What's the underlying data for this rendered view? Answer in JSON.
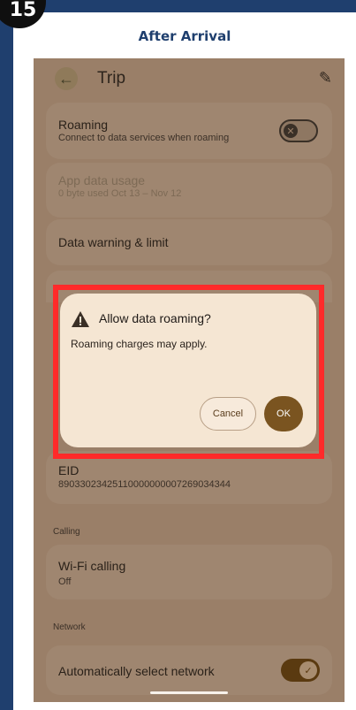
{
  "step": "15",
  "caption": "After Arrival",
  "app_bar": {
    "title": "Trip",
    "back_icon": "←",
    "edit_icon": "✎"
  },
  "settings": {
    "roaming": {
      "label": "Roaming",
      "sub": "Connect to data services when roaming",
      "state": "off"
    },
    "app_data_usage": {
      "label": "App data usage",
      "sub": "0 byte used Oct 13 – Nov 12"
    },
    "data_warning": {
      "label": "Data warning & limit"
    },
    "eid": {
      "label": "EID",
      "value": "89033023425110000000007269034344"
    },
    "calling_section": "Calling",
    "wifi_calling": {
      "label": "Wi-Fi calling",
      "sub": "Off"
    },
    "network_section": "Network",
    "auto_network": {
      "label": "Automatically select network",
      "state": "on"
    }
  },
  "dialog": {
    "title": "Allow data roaming?",
    "body": "Roaming charges may apply.",
    "cancel": "Cancel",
    "ok": "OK"
  },
  "colors": {
    "highlight": "#ff2a2a",
    "accent": "#7a5420",
    "frame": "#1f3f6e"
  }
}
